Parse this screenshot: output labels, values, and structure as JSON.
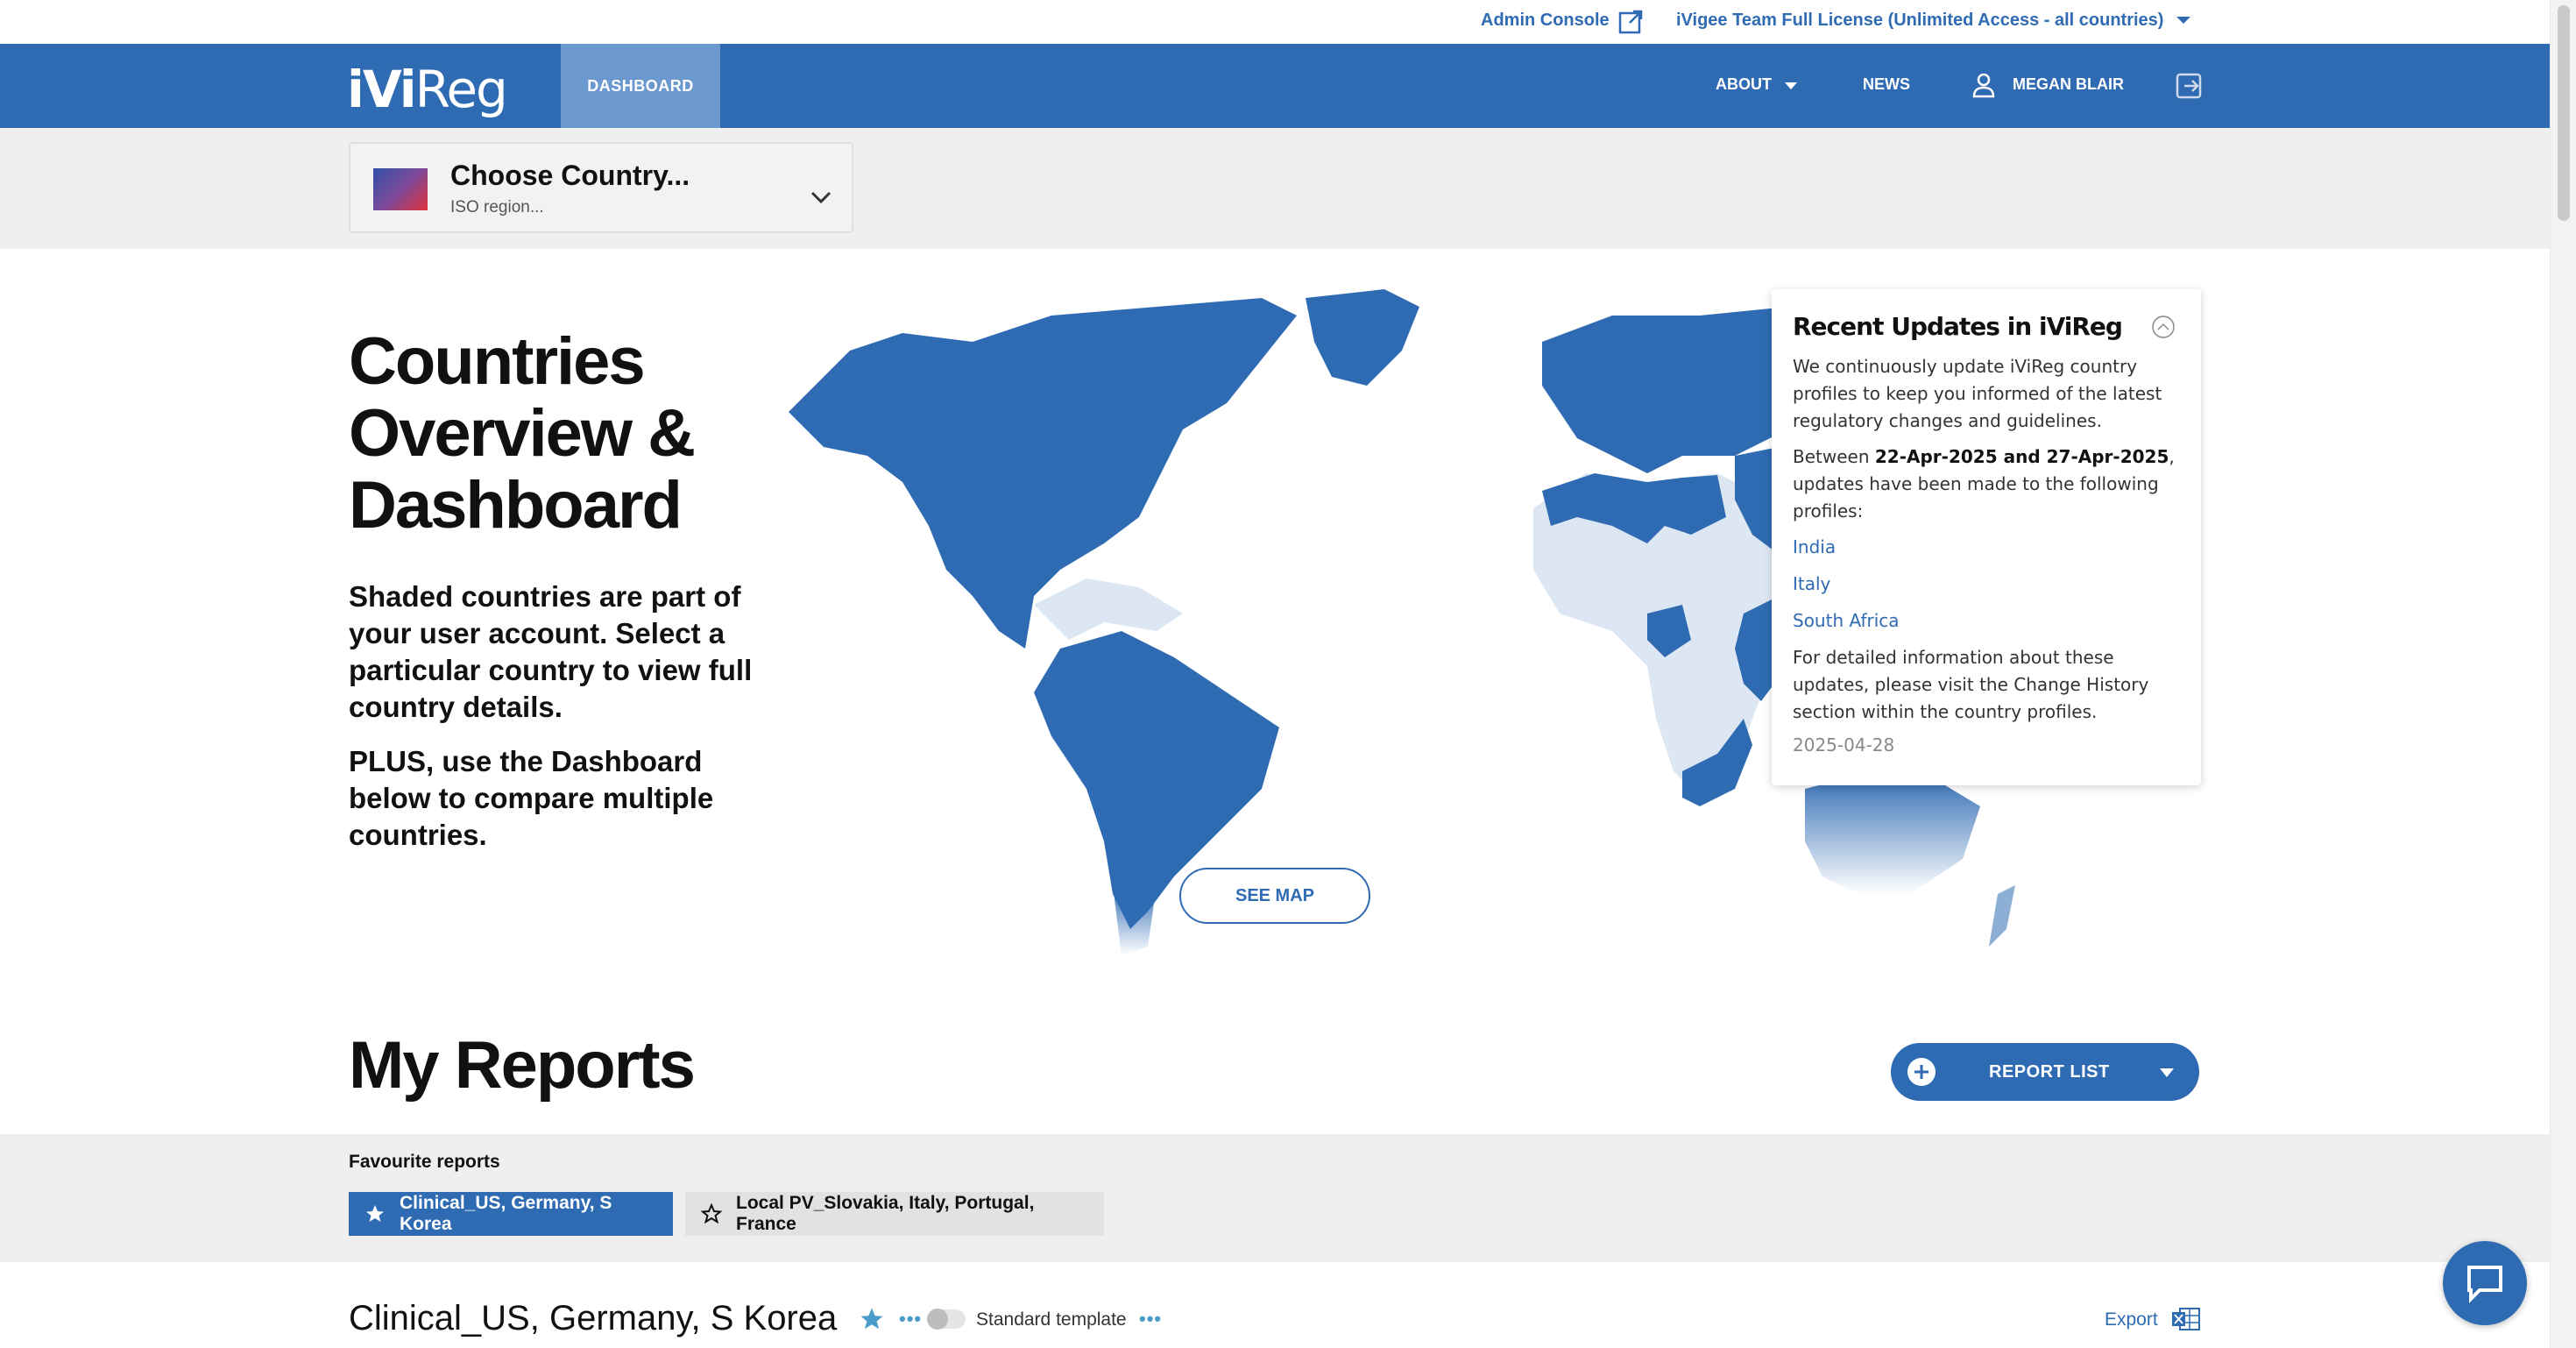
{
  "topbar": {
    "admin_console": "Admin Console",
    "license": "iVigee Team Full License (Unlimited Access - all countries)"
  },
  "nav": {
    "logo_a": "iVi",
    "logo_b": "Reg",
    "dashboard": "DASHBOARD",
    "about": "ABOUT",
    "news": "NEWS",
    "user": "MEGAN BLAIR"
  },
  "chooser": {
    "title": "Choose Country...",
    "subtitle": "ISO region..."
  },
  "hero": {
    "title": "Countries Overview & Dashboard",
    "p1": "Shaded countries are part of your user account.  Select a particular country to view full country details.",
    "p2": "PLUS, use the Dashboard below to compare multiple countries.",
    "see_map": "SEE MAP"
  },
  "updates": {
    "title": "Recent Updates in iViReg",
    "intro": "We continuously update iViReg country profiles to keep you informed of the latest regulatory changes and guidelines.",
    "between_pre": "Between ",
    "range": "22-Apr-2025 and 27-Apr-2025",
    "between_post": ", updates have been made to the following profiles:",
    "countries": [
      "India",
      "Italy",
      "South Africa"
    ],
    "footer": "For detailed information about these updates, please visit the Change History section within the country profiles.",
    "date": "2025-04-28"
  },
  "reports": {
    "title": "My Reports",
    "report_list": "REPORT LIST",
    "favourites_label": "Favourite reports",
    "favourites": [
      {
        "label": "Clinical_US, Germany, S Korea",
        "active": true
      },
      {
        "label": "Local PV_Slovakia, Italy, Portugal, France",
        "active": false
      }
    ],
    "current_title": "Clinical_US, Germany, S Korea",
    "dots": "•••",
    "template_label": "Standard template",
    "export": "Export"
  },
  "colors": {
    "brand_blue": "#2f6bb3",
    "nav_active": "#6a98cf",
    "map_shaded": "#2f6bb3",
    "map_unshaded": "#dde7f3"
  },
  "icons": [
    "external-link-icon",
    "caret-down-icon",
    "user-icon",
    "logout-icon",
    "chevron-down-icon",
    "collapse-up-icon",
    "plus-circle-icon",
    "star-filled-icon",
    "star-outline-icon",
    "excel-icon",
    "chat-icon"
  ]
}
